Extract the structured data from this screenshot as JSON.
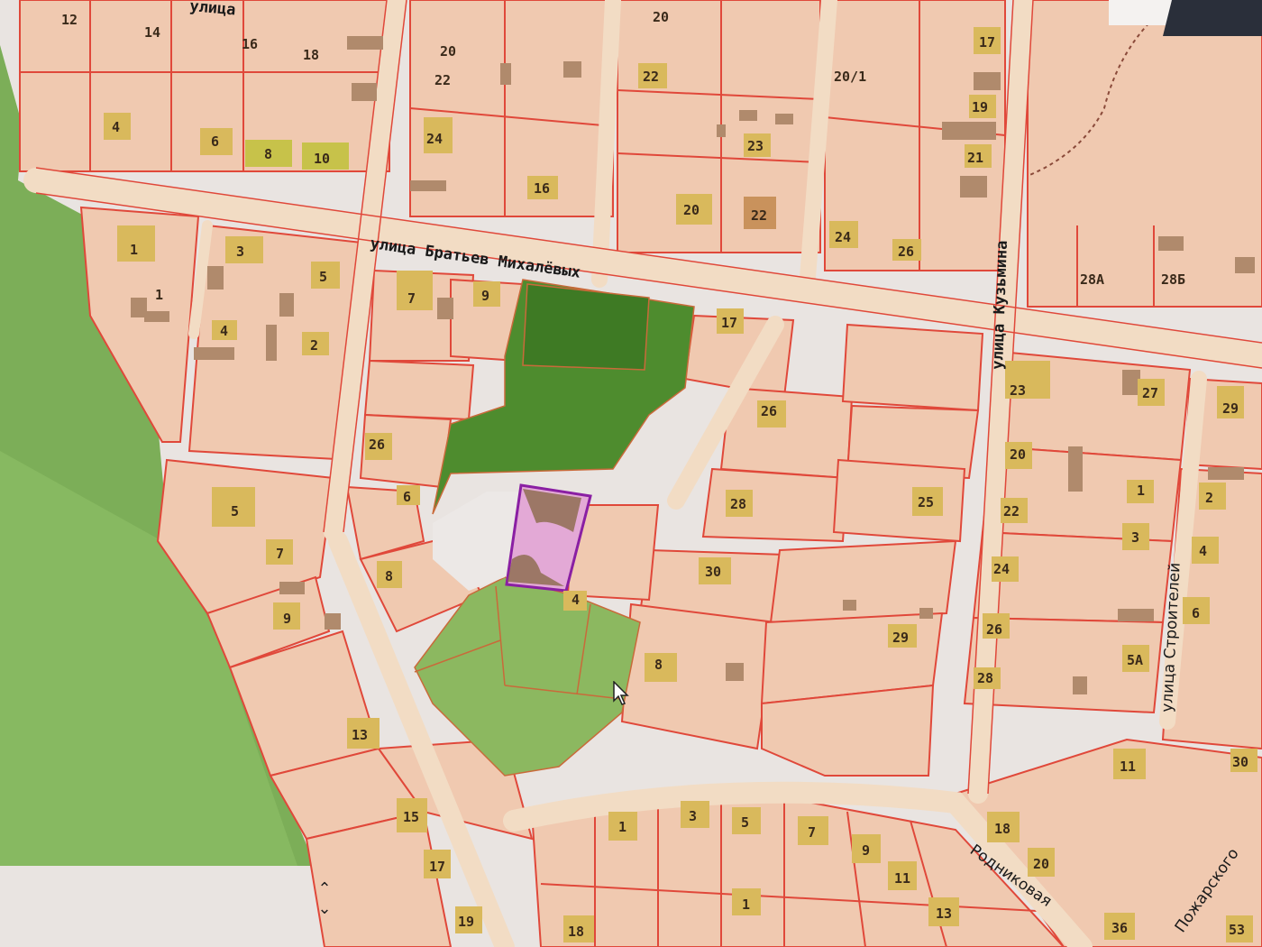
{
  "colors": {
    "background": "#e9e4e1",
    "parcel_fill": "#f0c9b0",
    "parcel_line": "#e0483a",
    "road": "#f2e2cf",
    "house": "#d9b95c",
    "building": "#b08a6c",
    "forest": "#6fa34a",
    "selected": "#8a1fa3"
  },
  "streets": [
    {
      "id": "top",
      "label": "улица"
    },
    {
      "id": "mikhalevykh",
      "label": "улица Братьев Михалёвых"
    },
    {
      "id": "kuzmina",
      "label": "улица Кузьмина"
    },
    {
      "id": "stroiteley",
      "label": "улица Строителей"
    },
    {
      "id": "rodnikovaya",
      "label": "Родниковая"
    },
    {
      "id": "pozharskogo",
      "label": "Пожарского"
    }
  ],
  "house_numbers": [
    "12",
    "14",
    "16",
    "18",
    "20",
    "22",
    "24",
    "4",
    "6",
    "8",
    "10",
    "16",
    "20",
    "22",
    "23",
    "20",
    "22",
    "17",
    "19",
    "21",
    "24",
    "26",
    "28А",
    "28Б",
    "1",
    "3",
    "5",
    "1",
    "4",
    "2",
    "7",
    "9",
    "17",
    "26",
    "6",
    "5",
    "7",
    "9",
    "8",
    "13",
    "15",
    "17",
    "19",
    "4",
    "26",
    "28",
    "30",
    "8",
    "25",
    "23",
    "27",
    "29",
    "20",
    "22",
    "24",
    "26",
    "28",
    "1",
    "2",
    "3",
    "4",
    "6",
    "5А",
    "29",
    "11",
    "18",
    "20",
    "30",
    "1",
    "3",
    "5",
    "7",
    "9",
    "11",
    "13",
    "1",
    "18",
    "36",
    "53",
    "20/1"
  ],
  "controls": {
    "up": "⌃",
    "down": "⌄"
  },
  "selected_parcel": {
    "label": "выделенный участок"
  }
}
